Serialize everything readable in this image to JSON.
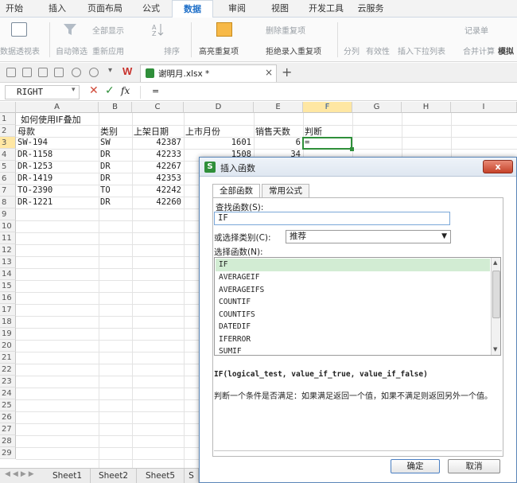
{
  "menu": {
    "tabs": [
      {
        "label": "开始"
      },
      {
        "label": "插入"
      },
      {
        "label": "页面布局"
      },
      {
        "label": "公式"
      },
      {
        "label": "数据"
      },
      {
        "label": "审阅"
      },
      {
        "label": "视图"
      },
      {
        "label": "开发工具"
      },
      {
        "label": "云服务"
      }
    ],
    "active_tab": "数据"
  },
  "ribbon": {
    "pivot": "数据透视表",
    "autofilter": "自动筛选",
    "show_all": "全部显示",
    "reapply": "重新应用",
    "sort": "排序",
    "highlight_dup": "高亮重复项",
    "delete_dup": "删除重复项",
    "reject_dup": "拒绝录入重复项",
    "split": "分列",
    "validity": "有效性",
    "dropdown": "插入下拉列表",
    "record": "记录单",
    "merge_calc": "合并计算",
    "sim": "模拟"
  },
  "document": {
    "filename": "谢明月.xlsx *"
  },
  "formula_bar": {
    "name_box": "RIGHT",
    "content": "=",
    "fx": "fx"
  },
  "grid": {
    "columns": [
      "A",
      "B",
      "C",
      "D",
      "E",
      "F",
      "G",
      "H",
      "I"
    ],
    "selected_column": "F",
    "selected_row": "3",
    "rows": [
      "1",
      "2",
      "3",
      "4",
      "5",
      "6",
      "7",
      "8",
      "9",
      "10",
      "11",
      "12",
      "13",
      "14",
      "15",
      "16",
      "17",
      "18",
      "19",
      "20",
      "21",
      "22",
      "23",
      "24",
      "25",
      "26",
      "27",
      "28",
      "29"
    ],
    "title": "如何使用IF叠加",
    "headers": {
      "a": "母款",
      "b": "类别",
      "c": "上架日期",
      "d": "上市月份",
      "e": "销售天数",
      "f": "判断"
    },
    "data": [
      {
        "a": "SW-194",
        "b": "SW",
        "c": "42387",
        "d": "1601",
        "e": "6",
        "f": "="
      },
      {
        "a": "DR-1158",
        "b": "DR",
        "c": "42233",
        "d": "1508",
        "e": "34",
        "f": ""
      },
      {
        "a": "DR-1253",
        "b": "DR",
        "c": "42267",
        "d": "",
        "e": "",
        "f": ""
      },
      {
        "a": "DR-1419",
        "b": "DR",
        "c": "42353",
        "d": "",
        "e": "",
        "f": ""
      },
      {
        "a": "TO-2390",
        "b": "TO",
        "c": "42242",
        "d": "",
        "e": "",
        "f": ""
      },
      {
        "a": "DR-1221",
        "b": "DR",
        "c": "42260",
        "d": "",
        "e": "",
        "f": ""
      }
    ]
  },
  "sheets": [
    {
      "label": "Sheet1"
    },
    {
      "label": "Sheet2"
    },
    {
      "label": "Sheet5"
    },
    {
      "label": "S"
    }
  ],
  "dialog": {
    "title": "插入函数",
    "tab_all": "全部函数",
    "tab_common": "常用公式",
    "search_label": "查找函数(S):",
    "search_value": "IF",
    "category_label": "或选择类别(C):",
    "category_value": "推荐",
    "select_label": "选择函数(N):",
    "functions": [
      "IF",
      "AVERAGEIF",
      "AVERAGEIFS",
      "COUNTIF",
      "COUNTIFS",
      "DATEDIF",
      "IFERROR",
      "SUMIF"
    ],
    "selected_function": "IF",
    "signature": "IF(logical_test, value_if_true, value_if_false)",
    "description": "判断一个条件是否满足：如果满足返回一个值，如果不满足则返回另外一个值。",
    "ok": "确定",
    "cancel": "取消",
    "close": "x"
  },
  "colors": {
    "accent": "#1e6fc8",
    "selection": "#d2ecd3",
    "cell_border": "#2f8f3a",
    "wps_red": "#c8302b"
  }
}
